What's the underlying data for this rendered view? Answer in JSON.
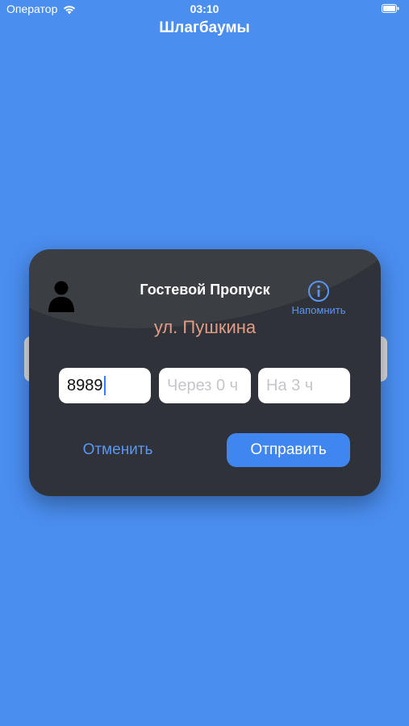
{
  "status_bar": {
    "carrier": "Оператор",
    "time": "03:10",
    "icons": [
      "wifi-icon",
      "battery-icon"
    ]
  },
  "nav": {
    "title": "Шлагбаумы"
  },
  "dialog": {
    "title": "Гостевой Пропуск",
    "remind_label": "Напомнить",
    "address": "ул. Пушкина",
    "phone_value": "8989",
    "start_placeholder": "Через 0 ч",
    "duration_placeholder": "На 3 ч",
    "cancel_label": "Отменить",
    "send_label": "Отправить",
    "icons": [
      "person-icon",
      "info-icon"
    ]
  },
  "colors": {
    "background": "#4a8ef0",
    "card": "#2f3339",
    "accent": "#5b95f2",
    "address": "#e39b86",
    "send_button": "#3f86f0"
  }
}
